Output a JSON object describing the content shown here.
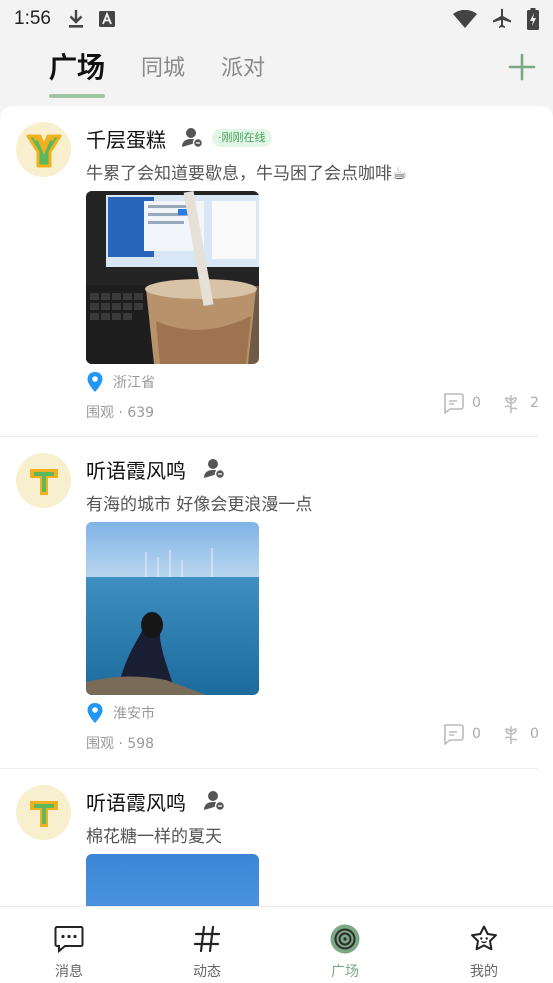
{
  "status_bar": {
    "time": "1:56",
    "left_icons": [
      "download-icon",
      "a-box-icon"
    ],
    "right_icons": [
      "wifi-icon",
      "airplane-icon",
      "battery-charging-icon"
    ]
  },
  "tabs": [
    {
      "label": "广场",
      "active": true
    },
    {
      "label": "同城",
      "active": false
    },
    {
      "label": "派对",
      "active": false
    }
  ],
  "colors": {
    "accent": "#7aa884",
    "online_badge_bg": "#e3f5e6",
    "online_badge_text": "#45a35a",
    "location_pin": "#2196f3"
  },
  "posts": [
    {
      "username": "千层蛋糕",
      "online_badge": "·刚刚在线",
      "text": "牛累了会知道要歇息，牛马困了会点咖啡☕",
      "image": "iced-coffee-photo",
      "location": "浙江省",
      "views": "围观 · 639",
      "comments": "0",
      "likes": "2"
    },
    {
      "username": "听语霞风鸣",
      "online_badge": "",
      "text": "有海的城市 好像会更浪漫一点",
      "image": "sea-photo",
      "location": "淮安市",
      "views": "围观 · 598",
      "comments": "0",
      "likes": "0"
    },
    {
      "username": "听语霞风鸣",
      "online_badge": "",
      "text": "棉花糖一样的夏天",
      "image": "sky-photo"
    }
  ],
  "bottom_nav": [
    {
      "label": "消息",
      "icon": "message-icon",
      "active": false
    },
    {
      "label": "动态",
      "icon": "hashtag-icon",
      "active": false
    },
    {
      "label": "广场",
      "icon": "plaza-spiral-icon",
      "active": true
    },
    {
      "label": "我的",
      "icon": "star-face-icon",
      "active": false
    }
  ]
}
